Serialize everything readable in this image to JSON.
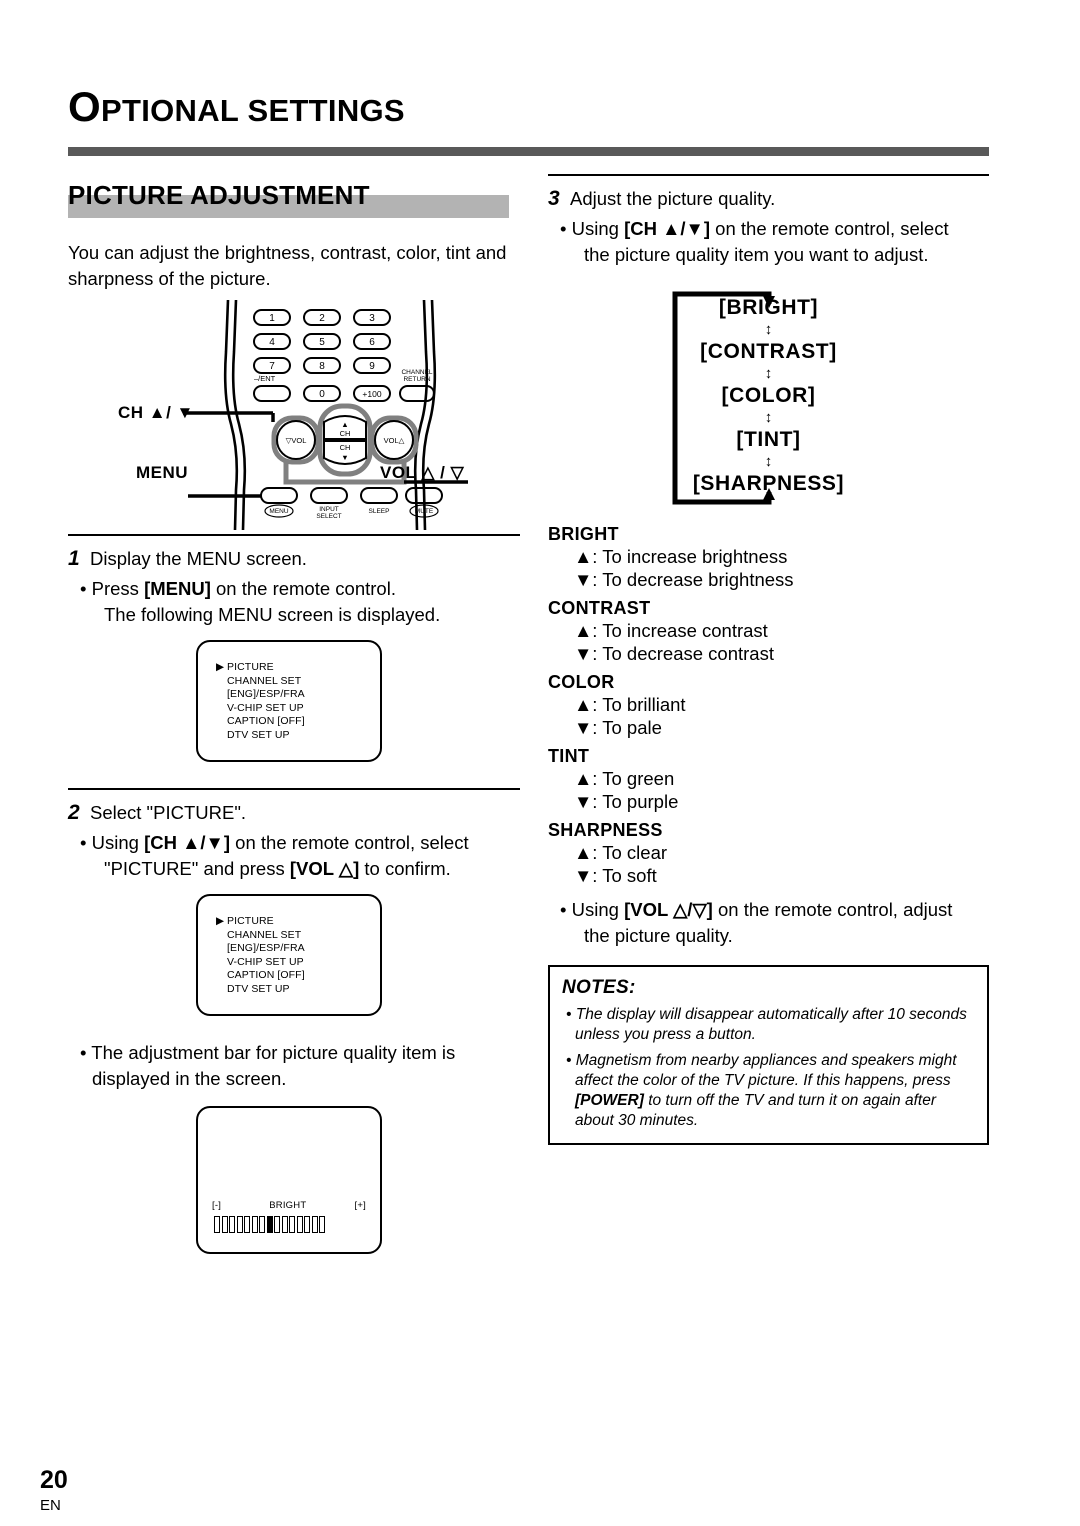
{
  "chapter": {
    "drop_cap": "O",
    "rest": "PTIONAL SETTINGS"
  },
  "section": {
    "title": "PICTURE ADJUSTMENT"
  },
  "intro": "You can adjust the brightness, contrast, color, tint and sharpness of the picture.",
  "remote": {
    "label_ch": "CH ▲/ ▼",
    "label_menu": "MENU",
    "label_vol": "VOL △ / ▽",
    "keys": [
      "1",
      "2",
      "3",
      "4",
      "5",
      "6",
      "7",
      "8",
      "9",
      "0",
      "+100"
    ],
    "key_ent": "–/ENT",
    "key_channel_return": "CHANNEL RETURN",
    "pad": {
      "ch_up": "CH",
      "ch_down": "CH",
      "vol_down": "VOL",
      "vol_up": "VOL"
    },
    "bottom_keys": [
      "MENU",
      "INPUT SELECT",
      "SLEEP",
      "MUTE"
    ]
  },
  "steps": [
    {
      "num": "1",
      "title": "Display the MENU screen.",
      "bullet_main": "Press ",
      "bullet_bold": "[MENU]",
      "bullet_tail": " on the remote control.",
      "bullet_cont": "The following MENU screen is displayed."
    },
    {
      "num": "2",
      "title": "Select \"PICTURE\".",
      "bullet_main": "Using ",
      "bullet_bold": "[CH ▲/▼]",
      "bullet_tail": " on the remote control, select",
      "bullet_cont_pre": "\"PICTURE\" and press ",
      "bullet_cont_bold": "[VOL △]",
      "bullet_cont_tail": " to confirm."
    }
  ],
  "step2_note": "The adjustment bar for picture quality item is displayed in the screen.",
  "osd_menu": {
    "caret": "▶",
    "items": [
      "PICTURE",
      "CHANNEL SET",
      "[ENG]/ESP/FRA",
      "V-CHIP SET UP",
      "CAPTION [OFF]",
      "DTV SET UP"
    ],
    "selected_index": 0
  },
  "osd_bar": {
    "minus": "[-]",
    "label": "BRIGHT",
    "plus": "[+]",
    "segments_total": 15,
    "active_index": 7
  },
  "step3": {
    "num": "3",
    "title": "Adjust the picture quality.",
    "bullet_main": "Using ",
    "bullet_bold": "[CH ▲/▼]",
    "bullet_tail": " on the remote control, select",
    "bullet_cont": "the picture quality item you want to adjust."
  },
  "cycle": {
    "items": [
      "[BRIGHT]",
      "[CONTRAST]",
      "[COLOR]",
      "[TINT]",
      "[SHARPNESS]"
    ],
    "connector": "↕"
  },
  "adjustments": [
    {
      "name": "BRIGHT",
      "up": "▲: To increase brightness",
      "down": "▼: To decrease brightness"
    },
    {
      "name": "CONTRAST",
      "up": "▲: To increase contrast",
      "down": "▼: To decrease contrast"
    },
    {
      "name": "COLOR",
      "up": "▲: To brilliant",
      "down": "▼: To pale"
    },
    {
      "name": "TINT",
      "up": "▲: To green",
      "down": "▼: To purple"
    },
    {
      "name": "SHARPNESS",
      "up": "▲: To clear",
      "down": "▼: To soft"
    }
  ],
  "vol_bullet": {
    "main": "Using ",
    "bold": "[VOL △/▽]",
    "tail": " on the remote control, adjust",
    "cont": "the picture quality."
  },
  "notes": {
    "head": "NOTES:",
    "items": [
      {
        "pre": "The display will disappear automatically after 10 seconds unless you press a button."
      },
      {
        "pre": "Magnetism from nearby appliances and speakers might affect the color of the TV picture. If this happens, press ",
        "bold": "[POWER]",
        "post": " to turn off the TV and turn it on again after about 30 minutes."
      }
    ]
  },
  "footer": {
    "page": "20",
    "lang": "EN"
  },
  "colors": {
    "rule": "#595959",
    "band": "#b3b3b3",
    "ink": "#000000",
    "remote_highlight": "#808080"
  }
}
